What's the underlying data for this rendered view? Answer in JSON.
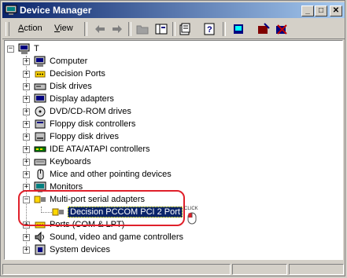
{
  "window": {
    "title": "Device Manager"
  },
  "title_buttons": {
    "minimize": "_",
    "maximize": "□",
    "close": "✕"
  },
  "menu": {
    "action": {
      "mnemonic": "A",
      "rest": "ction"
    },
    "view": {
      "mnemonic": "V",
      "rest": "iew"
    }
  },
  "toolbar": [
    "back-icon",
    "forward-icon",
    "up-folder-icon",
    "show-hide-tree-icon",
    "properties-icon",
    "help-icon",
    "scan-hardware-icon",
    "update-driver-icon",
    "uninstall-icon"
  ],
  "tree": {
    "root": "T",
    "items": [
      {
        "label": "Computer",
        "icon": "computer-icon"
      },
      {
        "label": "Decision Ports",
        "icon": "port-icon"
      },
      {
        "label": "Disk drives",
        "icon": "disk-drive-icon"
      },
      {
        "label": "Display adapters",
        "icon": "display-icon"
      },
      {
        "label": "DVD/CD-ROM drives",
        "icon": "cdrom-icon"
      },
      {
        "label": "Floppy disk controllers",
        "icon": "floppy-controller-icon"
      },
      {
        "label": "Floppy disk drives",
        "icon": "floppy-drive-icon"
      },
      {
        "label": "IDE ATA/ATAPI controllers",
        "icon": "ide-controller-icon"
      },
      {
        "label": "Keyboards",
        "icon": "keyboard-icon"
      },
      {
        "label": "Mice and other pointing devices",
        "icon": "mouse-icon"
      },
      {
        "label": "Monitors",
        "icon": "monitor-icon"
      },
      {
        "label": "Multi-port serial adapters",
        "icon": "serial-adapter-icon",
        "expanded": true,
        "children": [
          {
            "label": "Decision PCCOM PCI 2 Port",
            "icon": "serial-adapter-icon",
            "selected": true
          }
        ]
      },
      {
        "label": "Ports (COM & LPT)",
        "icon": "port-icon"
      },
      {
        "label": "Sound, video and game controllers",
        "icon": "sound-icon"
      },
      {
        "label": "System devices",
        "icon": "system-icon"
      }
    ]
  },
  "annotation": {
    "click_text": "CLICK"
  },
  "colors": {
    "title_start": "#0a246a",
    "title_end": "#a6caf0",
    "highlight": "#e0202a",
    "selection": "#0a246a"
  }
}
